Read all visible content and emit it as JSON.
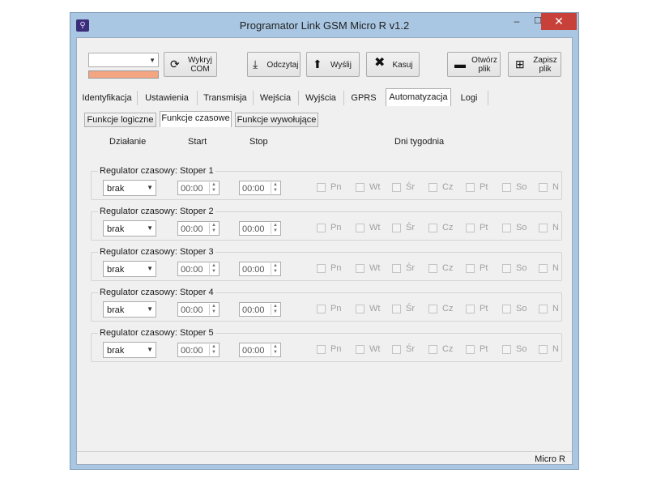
{
  "window": {
    "title": "Programator Link GSM Micro R v1.2",
    "controls": {
      "minimize": "‒",
      "maximize": "☐",
      "close": "✕"
    }
  },
  "toolbar": {
    "com_combo_value": "",
    "refresh_com_label_line1": "Wykryj",
    "refresh_com_label_line2": "COM",
    "read_label": "Odczytaj",
    "send_label": "Wyślij",
    "delete_label": "Kasuj",
    "open_label_line1": "Otwórz",
    "open_label_line2": "plik",
    "save_label_line1": "Zapisz",
    "save_label_line2": "plik"
  },
  "tabs": [
    {
      "label": "Identyfikacja",
      "active": false
    },
    {
      "label": "Ustawienia",
      "active": false
    },
    {
      "label": "Transmisja",
      "active": false
    },
    {
      "label": "Wejścia",
      "active": false
    },
    {
      "label": "Wyjścia",
      "active": false
    },
    {
      "label": "GPRS",
      "active": false
    },
    {
      "label": "Automatyzacja",
      "active": true
    },
    {
      "label": "Logi",
      "active": false
    }
  ],
  "subtabs": [
    {
      "label": "Funkcje logiczne",
      "active": false
    },
    {
      "label": "Funkcje czasowe",
      "active": true
    },
    {
      "label": "Funkcje wywołujące",
      "active": false
    }
  ],
  "headers": {
    "action": "Działanie",
    "start": "Start",
    "stop": "Stop",
    "weekdays": "Dni tygodnia"
  },
  "days": [
    "Pn",
    "Wt",
    "Śr",
    "Cz",
    "Pt",
    "So",
    "N"
  ],
  "timers": [
    {
      "title": "Regulator czasowy: Stoper 1",
      "mode": "brak",
      "start": "00:00",
      "stop": "00:00"
    },
    {
      "title": "Regulator czasowy: Stoper 2",
      "mode": "brak",
      "start": "00:00",
      "stop": "00:00"
    },
    {
      "title": "Regulator czasowy: Stoper 3",
      "mode": "brak",
      "start": "00:00",
      "stop": "00:00"
    },
    {
      "title": "Regulator czasowy: Stoper 4",
      "mode": "brak",
      "start": "00:00",
      "stop": "00:00"
    },
    {
      "title": "Regulator czasowy: Stoper 5",
      "mode": "brak",
      "start": "00:00",
      "stop": "00:00"
    }
  ],
  "status": {
    "device": "Micro R"
  },
  "colors": {
    "frame": "#a9c7e3",
    "close": "#c7403a",
    "com_status": "#f4a582"
  }
}
